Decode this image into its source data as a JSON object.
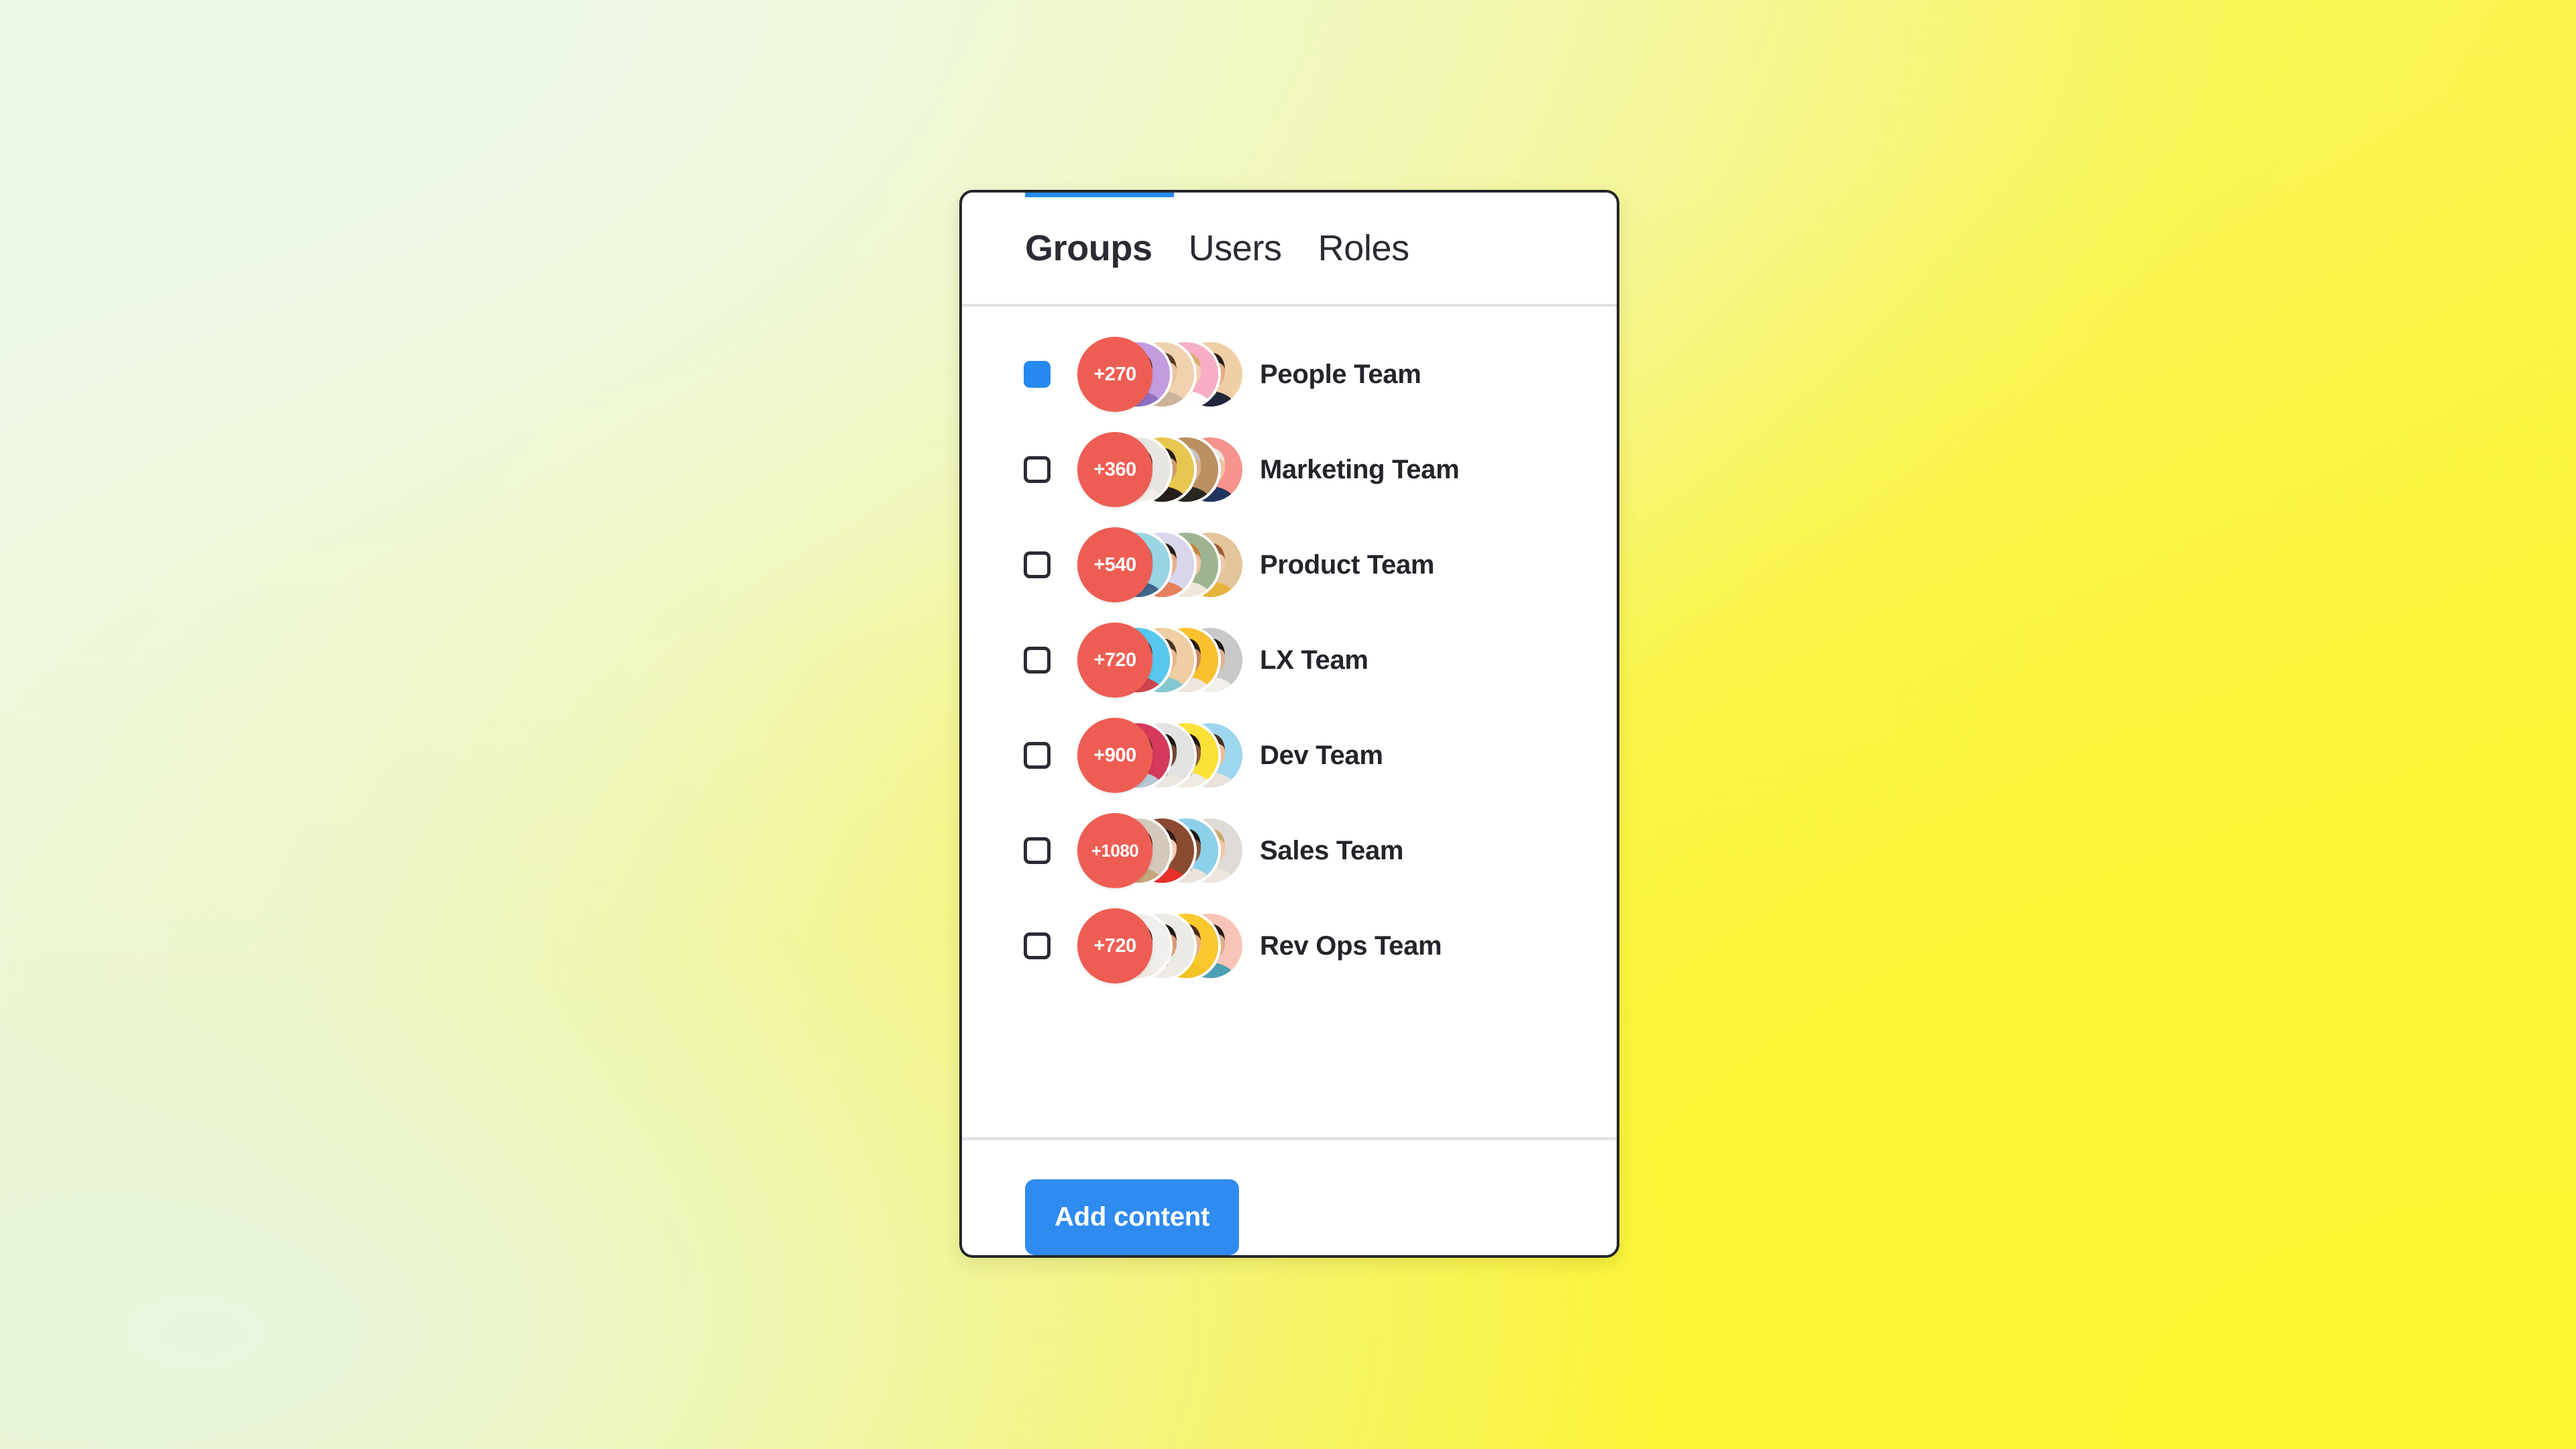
{
  "background": {
    "gradient_from": "#eef8e8",
    "gradient_to": "#fbf434"
  },
  "card": {
    "border_color": "#25252b",
    "background": "#ffffff"
  },
  "tabs": {
    "active_index": 0,
    "underline_color": "#2589ef",
    "items": [
      {
        "label": "Groups"
      },
      {
        "label": "Users"
      },
      {
        "label": "Roles"
      }
    ]
  },
  "groups": {
    "badge_color": "#ee5d53",
    "checkbox_checked_color": "#2589ef",
    "rows": [
      {
        "label": "People Team",
        "badge": "+270",
        "checked": true,
        "avatars": [
          {
            "name": "avatar-bearded-man",
            "ring": "#c49bdf",
            "skin": "#e5b091",
            "hair": "#2e2220",
            "shirt": "#8e6fc0"
          },
          {
            "name": "avatar-smiling-woman",
            "ring": "#f0d2ae",
            "skin": "#eec3a1",
            "hair": "#5a3a25",
            "shirt": "#cbb49b"
          },
          {
            "name": "avatar-blonde-woman",
            "ring": "#f7aec4",
            "skin": "#f2cdae",
            "hair": "#d8b070",
            "shirt": "#ffffff"
          },
          {
            "name": "avatar-dark-hair-man",
            "ring": "#f0cfa6",
            "skin": "#e3ab85",
            "hair": "#241c1a",
            "shirt": "#21263b"
          }
        ]
      },
      {
        "label": "Marketing Team",
        "badge": "+360",
        "checked": false,
        "avatars": [
          {
            "name": "avatar-curly-woman-glasses",
            "ring": "#e8e6e3",
            "skin": "#d79e72",
            "hair": "#3a2418",
            "shirt": "#f2efe9"
          },
          {
            "name": "avatar-bearded-man-dark",
            "ring": "#e8c64f",
            "skin": "#cf9a6d",
            "hair": "#251a16",
            "shirt": "#241f1d"
          },
          {
            "name": "avatar-grey-beard-man",
            "ring": "#bb9061",
            "skin": "#dbb192",
            "hair": "#c9c2bb",
            "shirt": "#2a2622"
          },
          {
            "name": "avatar-platinum-woman",
            "ring": "#f5938c",
            "skin": "#eec1a3",
            "hair": "#ece5dc",
            "shirt": "#21355e"
          }
        ]
      },
      {
        "label": "Product Team",
        "badge": "+540",
        "checked": false,
        "avatars": [
          {
            "name": "avatar-older-man-denim",
            "ring": "#9ad4e3",
            "skin": "#dda885",
            "hair": "#7e7972",
            "shirt": "#40668e"
          },
          {
            "name": "avatar-woman-glasses",
            "ring": "#d7d6ea",
            "skin": "#e8ad87",
            "hair": "#2b1c16",
            "shirt": "#e87e5c"
          },
          {
            "name": "avatar-redhead-woman",
            "ring": "#9eb490",
            "skin": "#f0c6a7",
            "hair": "#c98341",
            "shirt": "#efe7dd"
          },
          {
            "name": "avatar-auburn-woman",
            "ring": "#e4c49a",
            "skin": "#f0c8a9",
            "hair": "#9c5a37",
            "shirt": "#e6b43d"
          }
        ]
      },
      {
        "label": "LX Team",
        "badge": "+720",
        "checked": false,
        "avatars": [
          {
            "name": "avatar-long-hair-woman",
            "ring": "#57c7ef",
            "skin": "#e7b28d",
            "hair": "#2a1d18",
            "shirt": "#d2444d"
          },
          {
            "name": "avatar-man-glasses-beard",
            "ring": "#f0cda2",
            "skin": "#e9b68f",
            "hair": "#4b3323",
            "shirt": "#82c7d0"
          },
          {
            "name": "avatar-smiling-woman-afro",
            "ring": "#fbc02d",
            "skin": "#c98a5e",
            "hair": "#2b1a12",
            "shirt": "#ece6de"
          },
          {
            "name": "avatar-dark-hair-woman",
            "ring": "#c8c8c8",
            "skin": "#e3b291",
            "hair": "#1f1713",
            "shirt": "#f3f0ec"
          }
        ]
      },
      {
        "label": "Dev Team",
        "badge": "+900",
        "checked": false,
        "avatars": [
          {
            "name": "avatar-asian-man",
            "ring": "#d5395b",
            "skin": "#eec1a1",
            "hair": "#2a1d17",
            "shirt": "#b7c8d4"
          },
          {
            "name": "avatar-man-glasses-dark",
            "ring": "#e2e2e2",
            "skin": "#6f4630",
            "hair": "#1a1210",
            "shirt": "#ebe6e0"
          },
          {
            "name": "avatar-young-man",
            "ring": "#fbe135",
            "skin": "#8d5c3c",
            "hair": "#1c130f",
            "shirt": "#efeae3"
          },
          {
            "name": "avatar-short-hair-woman",
            "ring": "#9ed6ef",
            "skin": "#edbd9b",
            "hair": "#4a2f20",
            "shirt": "#e9e3db"
          }
        ]
      },
      {
        "label": "Sales Team",
        "badge": "+1080",
        "checked": false,
        "avatars": [
          {
            "name": "avatar-man-glasses-curly",
            "ring": "#d5c9bc",
            "skin": "#8a5836",
            "hair": "#1c130f",
            "shirt": "#c6a77f"
          },
          {
            "name": "avatar-woman-red-top",
            "ring": "#8a4a32",
            "skin": "#f1cbb0",
            "hair": "#2d1c15",
            "shirt": "#e8302b"
          },
          {
            "name": "avatar-dreadlocks-man",
            "ring": "#8cd0ea",
            "skin": "#82543a",
            "hair": "#211611",
            "shirt": "#e9e3db"
          },
          {
            "name": "avatar-blonde-long-woman",
            "ring": "#dedbd6",
            "skin": "#f0c6a7",
            "hair": "#cda86f",
            "shirt": "#ece6de"
          }
        ]
      },
      {
        "label": "Rev Ops Team",
        "badge": "+720",
        "checked": false,
        "avatars": [
          {
            "name": "avatar-smiling-man-dark",
            "ring": "#f0efed",
            "skin": "#6b4330",
            "hair": "#1a120e",
            "shirt": "#efeae3"
          },
          {
            "name": "avatar-dark-hair-woman-2",
            "ring": "#eceae7",
            "skin": "#d79d76",
            "hair": "#201612",
            "shirt": "#efeae3"
          },
          {
            "name": "avatar-woman-yellow-top",
            "ring": "#fbc92d",
            "skin": "#e7b28d",
            "hair": "#4e2d1c",
            "shirt": "#f2c324"
          },
          {
            "name": "avatar-woman-teal-top",
            "ring": "#f8c4b8",
            "skin": "#ddae8c",
            "hair": "#2a1c15",
            "shirt": "#4d9fb3"
          }
        ]
      }
    ]
  },
  "footer": {
    "add_content_label": "Add content",
    "button_color": "#2f8bef"
  }
}
